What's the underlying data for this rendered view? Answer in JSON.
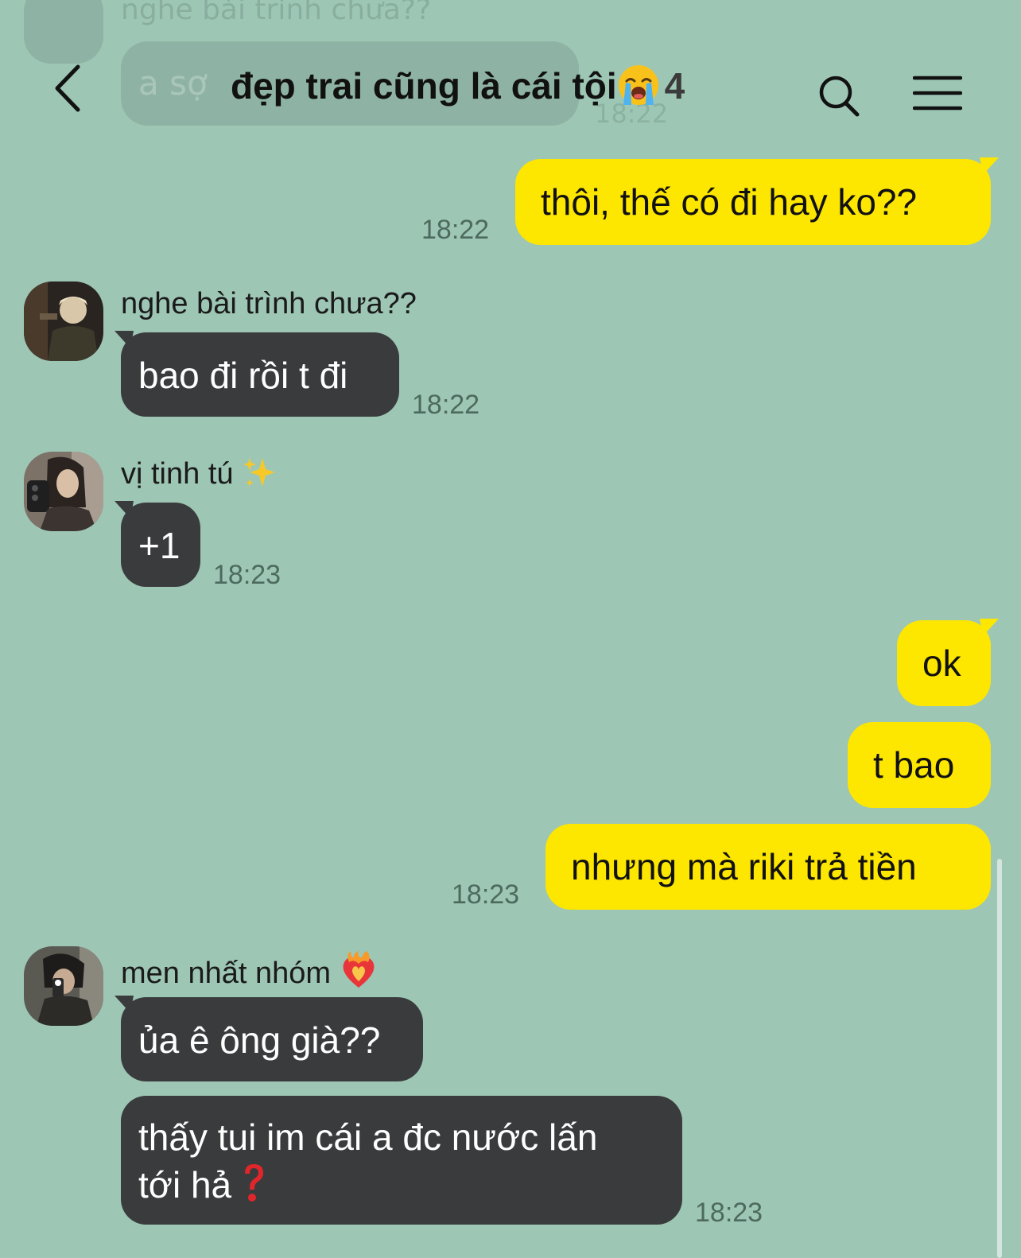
{
  "header": {
    "title": "đẹp trai cũng là cái tội",
    "member_count": "4"
  },
  "ghost": {
    "sender": "nghe bài trình chưa??",
    "message": "a sợ",
    "time": "18:22"
  },
  "messages": {
    "m1": {
      "text": "thôi, thế có đi hay ko??",
      "time": "18:22"
    },
    "m2": {
      "sender": "nghe bài trình chưa??",
      "text": "bao đi rồi t đi",
      "time": "18:22"
    },
    "m3": {
      "sender": "vị tinh tú",
      "text": "+1",
      "time": "18:23"
    },
    "m4": {
      "text": "ok"
    },
    "m5": {
      "text": "t bao"
    },
    "m6": {
      "text": "nhưng mà riki trả tiền",
      "time": "18:23"
    },
    "m7": {
      "sender": "men nhất nhóm",
      "text": "ủa ê ông già??"
    },
    "m8": {
      "text_line1": "thấy tui im cái a đc nước lấn",
      "text_line2": "tới hả",
      "time": "18:23"
    }
  },
  "icons": {
    "back": "chevron-left-icon",
    "search": "search-icon",
    "menu": "hamburger-menu-icon",
    "title_emoji": "crying-face-emoji",
    "sparkles": "sparkles-emoji",
    "heart_on_fire": "heart-on-fire-emoji",
    "question": "red-question-mark-emoji"
  },
  "colors": {
    "background": "#9dc6b5",
    "outgoing_bubble": "#fde600",
    "incoming_bubble": "#3a3b3d",
    "timestamp": "#4d6a5f"
  }
}
